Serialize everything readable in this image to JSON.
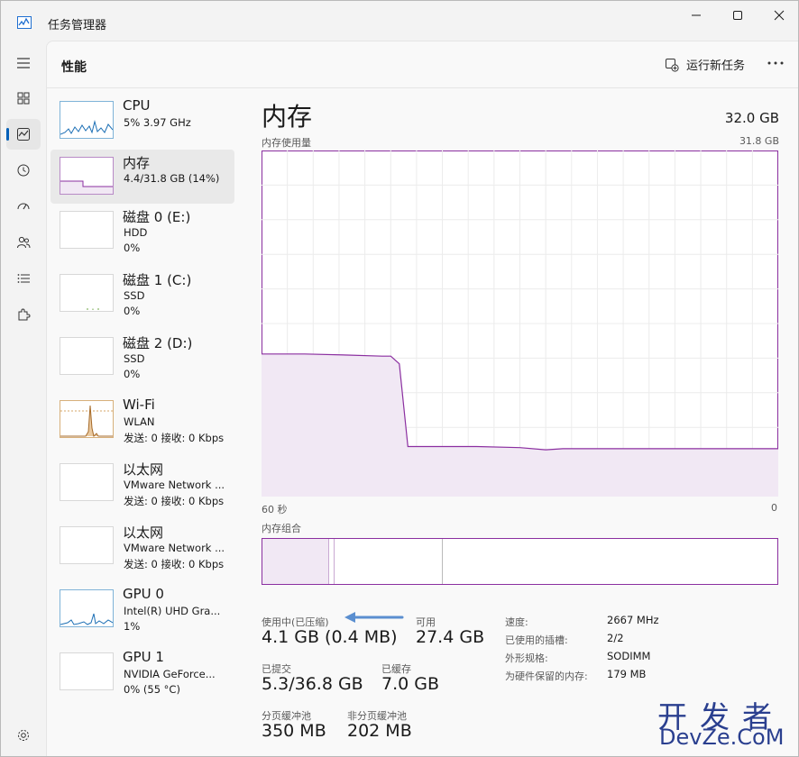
{
  "window": {
    "title": "任务管理器"
  },
  "header": {
    "title": "性能",
    "run_task": "运行新任务"
  },
  "devices": [
    {
      "name": "CPU",
      "line2": "5% 3.97 GHz",
      "line3": ""
    },
    {
      "name": "内存",
      "line2": "4.4/31.8 GB (14%)",
      "line3": ""
    },
    {
      "name": "磁盘 0 (E:)",
      "line2": "HDD",
      "line3": "0%"
    },
    {
      "name": "磁盘 1 (C:)",
      "line2": "SSD",
      "line3": "0%"
    },
    {
      "name": "磁盘 2 (D:)",
      "line2": "SSD",
      "line3": "0%"
    },
    {
      "name": "Wi-Fi",
      "line2": "WLAN",
      "line3": "发送: 0 接收: 0 Kbps"
    },
    {
      "name": "以太网",
      "line2": "VMware Network ...",
      "line3": "发送: 0 接收: 0 Kbps"
    },
    {
      "name": "以太网",
      "line2": "VMware Network ...",
      "line3": "发送: 0 接收: 0 Kbps"
    },
    {
      "name": "GPU 0",
      "line2": "Intel(R) UHD Gra...",
      "line3": "1%"
    },
    {
      "name": "GPU 1",
      "line2": "NVIDIA GeForce...",
      "line3": "0% (55 °C)"
    }
  ],
  "memory": {
    "title": "内存",
    "total": "32.0 GB",
    "usage_label": "内存使用量",
    "usage_max": "31.8 GB",
    "axis_left": "60 秒",
    "axis_right": "0",
    "composition_label": "内存组合",
    "stats": {
      "in_use_label": "使用中(已压缩)",
      "in_use_value": "4.1 GB (0.4 MB)",
      "available_label": "可用",
      "available_value": "27.4 GB",
      "committed_label": "已提交",
      "committed_value": "5.3/36.8 GB",
      "cached_label": "已缓存",
      "cached_value": "7.0 GB",
      "paged_label": "分页缓冲池",
      "paged_value": "350 MB",
      "nonpaged_label": "非分页缓冲池",
      "nonpaged_value": "202 MB"
    },
    "props": [
      {
        "label": "速度:",
        "value": "2667 MHz"
      },
      {
        "label": "已使用的插槽:",
        "value": "2/2"
      },
      {
        "label": "外形规格:",
        "value": "SODIMM"
      },
      {
        "label": "为硬件保留的内存:",
        "value": "179 MB"
      }
    ]
  },
  "chart_data": {
    "type": "area",
    "ylabel": "内存使用量",
    "ylim": [
      0,
      31.8
    ],
    "x": [
      60,
      55,
      50,
      46,
      45,
      44,
      43,
      40,
      35,
      30,
      27,
      25,
      20,
      15,
      10,
      5,
      0
    ],
    "series": [
      {
        "values": [
          13.1,
          13.1,
          13.0,
          12.9,
          12.9,
          12.2,
          4.6,
          4.6,
          4.6,
          4.5,
          4.3,
          4.4,
          4.4,
          4.4,
          4.4,
          4.4,
          4.4
        ]
      }
    ]
  },
  "watermark": {
    "line1": "开发者",
    "line2": "DevZe.CoM"
  },
  "colors": {
    "accent": "#005fb8",
    "memory": "#8b2fa0",
    "memory_fill": "#f1e8f4"
  }
}
